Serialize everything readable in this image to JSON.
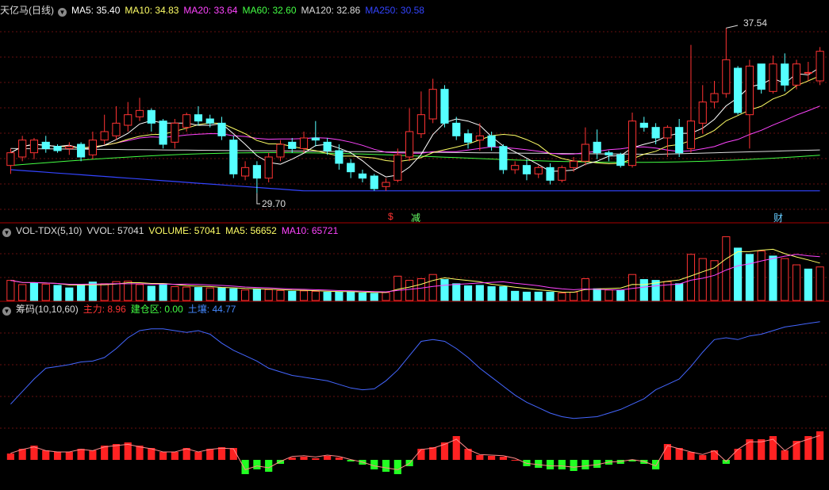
{
  "price_panel": {
    "title": "天亿马(日线)",
    "ma": [
      {
        "label": "MA5: 35.40",
        "color": "#ffffff"
      },
      {
        "label": "MA10: 34.83",
        "color": "#ffff66"
      },
      {
        "label": "MA20: 33.64",
        "color": "#ff44ff"
      },
      {
        "label": "MA60: 32.60",
        "color": "#44ff44"
      },
      {
        "label": "MA120: 32.86",
        "color": "#dddddd"
      },
      {
        "label": "MA250: 30.58",
        "color": "#3344ff"
      }
    ],
    "high_label": "37.54",
    "low_label": "29.70",
    "marks": [
      {
        "text": "$",
        "color": "#ff3333"
      },
      {
        "text": "减",
        "color": "#66ff66"
      },
      {
        "text": "财",
        "color": "#66ccff"
      }
    ]
  },
  "volume_panel": {
    "title": "VOL-TDX(5,10)",
    "items": [
      {
        "label": "VVOL: 57041",
        "color": "#dddddd"
      },
      {
        "label": "VOLUME: 57041",
        "color": "#ffff66"
      },
      {
        "label": "MA5: 56652",
        "color": "#ffff66"
      },
      {
        "label": "MA10: 65721",
        "color": "#ff44ff"
      }
    ]
  },
  "chip_panel": {
    "title": "筹码(10,10,60)",
    "items": [
      {
        "label": "主力: 8.96",
        "color": "#ff3333"
      },
      {
        "label": "建仓区: 0.00",
        "color": "#44ff44"
      },
      {
        "label": "土壤: 44.77",
        "color": "#4488ff"
      }
    ]
  },
  "chart_data": {
    "type": "candlestick",
    "price_range": [
      29.0,
      38.0
    ],
    "candles": [
      [
        31.0,
        31.6,
        30.6,
        31.8
      ],
      [
        31.4,
        32.2,
        31.2,
        32.4
      ],
      [
        31.6,
        32.2,
        31.3,
        32.3
      ],
      [
        32.1,
        31.8,
        31.6,
        32.4
      ],
      [
        31.9,
        31.7,
        31.6,
        32.0
      ],
      [
        31.8,
        31.9,
        31.5,
        32.1
      ],
      [
        32.0,
        31.4,
        31.2,
        32.1
      ],
      [
        31.5,
        32.2,
        31.3,
        32.6
      ],
      [
        32.2,
        32.6,
        32.0,
        33.4
      ],
      [
        32.4,
        33.0,
        32.2,
        33.8
      ],
      [
        32.9,
        33.4,
        32.6,
        34.0
      ],
      [
        33.3,
        33.6,
        33.1,
        34.2
      ],
      [
        33.6,
        33.0,
        32.6,
        33.7
      ],
      [
        33.1,
        32.0,
        31.8,
        33.2
      ],
      [
        32.1,
        33.0,
        31.8,
        33.2
      ],
      [
        32.8,
        33.4,
        32.6,
        33.5
      ],
      [
        33.4,
        33.1,
        32.9,
        33.8
      ],
      [
        33.2,
        33.0,
        32.8,
        33.4
      ],
      [
        33.0,
        32.4,
        32.2,
        33.3
      ],
      [
        32.2,
        30.6,
        30.4,
        32.4
      ],
      [
        30.5,
        30.9,
        30.3,
        31.2
      ],
      [
        31.0,
        30.4,
        29.7,
        31.2
      ],
      [
        30.4,
        31.4,
        30.2,
        31.6
      ],
      [
        31.4,
        32.0,
        31.2,
        32.2
      ],
      [
        32.1,
        31.8,
        31.6,
        32.3
      ],
      [
        31.8,
        32.3,
        31.6,
        32.6
      ],
      [
        32.3,
        32.2,
        31.9,
        33.1
      ],
      [
        32.1,
        31.7,
        31.5,
        32.3
      ],
      [
        31.7,
        31.1,
        30.8,
        32.0
      ],
      [
        31.1,
        30.7,
        30.4,
        31.3
      ],
      [
        30.6,
        30.4,
        30.2,
        30.8
      ],
      [
        30.5,
        29.9,
        29.8,
        30.6
      ],
      [
        30.0,
        30.2,
        29.8,
        30.4
      ],
      [
        30.3,
        31.5,
        30.2,
        31.8
      ],
      [
        31.4,
        32.6,
        31.2,
        33.7
      ],
      [
        32.5,
        33.4,
        32.3,
        34.5
      ],
      [
        33.2,
        34.6,
        33.0,
        35.1
      ],
      [
        34.6,
        33.0,
        32.8,
        34.8
      ],
      [
        33.0,
        32.4,
        32.2,
        33.3
      ],
      [
        32.5,
        32.1,
        31.8,
        32.7
      ],
      [
        32.2,
        32.4,
        31.7,
        33.0
      ],
      [
        32.4,
        31.9,
        31.7,
        32.6
      ],
      [
        31.9,
        30.8,
        30.6,
        32.0
      ],
      [
        30.8,
        31.0,
        30.6,
        31.2
      ],
      [
        31.0,
        30.6,
        30.3,
        31.3
      ],
      [
        30.6,
        30.9,
        30.4,
        31.0
      ],
      [
        30.9,
        30.3,
        30.1,
        31.1
      ],
      [
        30.3,
        30.9,
        30.2,
        31.0
      ],
      [
        30.9,
        31.2,
        30.7,
        31.4
      ],
      [
        31.2,
        32.0,
        31.0,
        32.8
      ],
      [
        32.1,
        31.6,
        31.3,
        32.7
      ],
      [
        31.6,
        31.5,
        31.2,
        31.7
      ],
      [
        31.5,
        31.0,
        30.9,
        31.6
      ],
      [
        31.0,
        33.1,
        30.9,
        33.5
      ],
      [
        33.0,
        32.8,
        32.6,
        33.3
      ],
      [
        32.8,
        32.3,
        32.0,
        33.0
      ],
      [
        32.3,
        32.8,
        31.4,
        32.9
      ],
      [
        32.8,
        31.6,
        31.4,
        33.2
      ],
      [
        31.8,
        33.1,
        31.6,
        36.7
      ],
      [
        33.0,
        34.0,
        32.5,
        34.8
      ],
      [
        34.0,
        34.4,
        33.7,
        35.0
      ],
      [
        34.4,
        36.0,
        34.2,
        37.5
      ],
      [
        35.6,
        33.5,
        33.4,
        35.7
      ],
      [
        33.4,
        35.7,
        31.8,
        36.0
      ],
      [
        35.8,
        34.6,
        34.4,
        35.8
      ],
      [
        34.5,
        35.8,
        34.4,
        36.2
      ],
      [
        35.8,
        34.8,
        34.5,
        36.3
      ],
      [
        34.8,
        35.8,
        34.6,
        36.0
      ],
      [
        35.4,
        35.4,
        35.0,
        35.9
      ],
      [
        35.0,
        36.4,
        34.8,
        36.6
      ]
    ],
    "volume": [
      [
        48,
        "up"
      ],
      [
        38,
        "up"
      ],
      [
        42,
        "down"
      ],
      [
        39,
        "up"
      ],
      [
        36,
        "down"
      ],
      [
        30,
        "down"
      ],
      [
        38,
        "down"
      ],
      [
        44,
        "down"
      ],
      [
        40,
        "up"
      ],
      [
        45,
        "up"
      ],
      [
        46,
        "up"
      ],
      [
        38,
        "up"
      ],
      [
        34,
        "down"
      ],
      [
        40,
        "down"
      ],
      [
        33,
        "up"
      ],
      [
        32,
        "up"
      ],
      [
        31,
        "down"
      ],
      [
        30,
        "up"
      ],
      [
        30,
        "down"
      ],
      [
        28,
        "down"
      ],
      [
        25,
        "up"
      ],
      [
        27,
        "down"
      ],
      [
        26,
        "up"
      ],
      [
        24,
        "up"
      ],
      [
        22,
        "down"
      ],
      [
        23,
        "up"
      ],
      [
        22,
        "up"
      ],
      [
        20,
        "down"
      ],
      [
        20,
        "down"
      ],
      [
        21,
        "down"
      ],
      [
        18,
        "down"
      ],
      [
        17,
        "down"
      ],
      [
        19,
        "up"
      ],
      [
        58,
        "up"
      ],
      [
        48,
        "up"
      ],
      [
        52,
        "up"
      ],
      [
        62,
        "up"
      ],
      [
        50,
        "down"
      ],
      [
        40,
        "down"
      ],
      [
        35,
        "down"
      ],
      [
        36,
        "down"
      ],
      [
        33,
        "down"
      ],
      [
        33,
        "down"
      ],
      [
        22,
        "down"
      ],
      [
        20,
        "down"
      ],
      [
        20,
        "down"
      ],
      [
        20,
        "down"
      ],
      [
        18,
        "up"
      ],
      [
        20,
        "up"
      ],
      [
        52,
        "up"
      ],
      [
        28,
        "down"
      ],
      [
        25,
        "up"
      ],
      [
        24,
        "down"
      ],
      [
        62,
        "up"
      ],
      [
        50,
        "down"
      ],
      [
        48,
        "down"
      ],
      [
        45,
        "up"
      ],
      [
        40,
        "down"
      ],
      [
        110,
        "up"
      ],
      [
        100,
        "up"
      ],
      [
        95,
        "up"
      ],
      [
        152,
        "up"
      ],
      [
        125,
        "down"
      ],
      [
        110,
        "down"
      ],
      [
        118,
        "up"
      ],
      [
        106,
        "down"
      ],
      [
        100,
        "up"
      ],
      [
        85,
        "up"
      ],
      [
        75,
        "down"
      ],
      [
        80,
        "up"
      ]
    ],
    "chip_soil": [
      18,
      32,
      46,
      58,
      60,
      62,
      65,
      66,
      70,
      80,
      92,
      100,
      102,
      102,
      100,
      98,
      100,
      96,
      86,
      78,
      72,
      66,
      58,
      54,
      50,
      48,
      46,
      44,
      40,
      36,
      34,
      35,
      44,
      56,
      72,
      88,
      90,
      88,
      80,
      70,
      58,
      48,
      38,
      28,
      20,
      14,
      8,
      4,
      2,
      3,
      4,
      8,
      12,
      18,
      24,
      34,
      40,
      46,
      60,
      76,
      90,
      92,
      90,
      94,
      96,
      100,
      104,
      106,
      108,
      110
    ],
    "chip_main": [
      8,
      14,
      18,
      12,
      10,
      10,
      14,
      12,
      18,
      20,
      22,
      18,
      15,
      10,
      10,
      15,
      10,
      14,
      16,
      15,
      -18,
      -12,
      -15,
      -5,
      3,
      4,
      2,
      5,
      3,
      -2,
      -6,
      -12,
      -15,
      -18,
      -8,
      14,
      16,
      22,
      30,
      14,
      6,
      5,
      4,
      0,
      -8,
      -10,
      -12,
      -12,
      -14,
      -12,
      -10,
      -6,
      -5,
      -2,
      -5,
      -12,
      20,
      15,
      10,
      6,
      12,
      -5,
      14,
      26,
      26,
      30,
      12,
      24,
      30,
      36
    ]
  }
}
